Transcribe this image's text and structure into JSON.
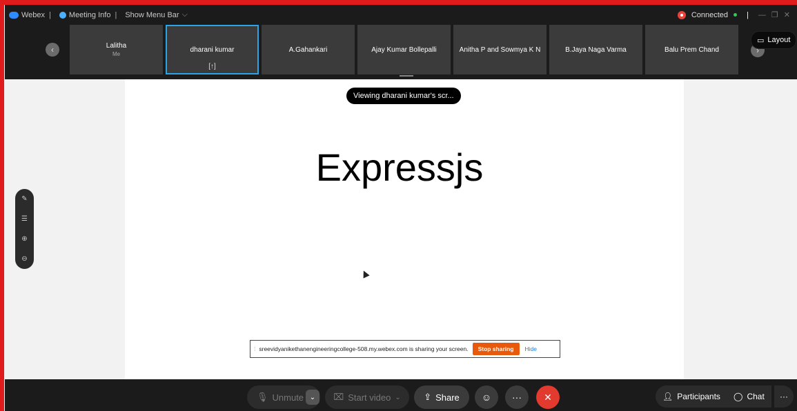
{
  "topbar": {
    "app_name": "Webex",
    "meeting_info": "Meeting Info",
    "show_menu_bar": "Show Menu Bar",
    "status": "Connected"
  },
  "participants_strip": {
    "tiles": [
      {
        "name": "Lalitha",
        "sub": "Me"
      },
      {
        "name": "dharani kumar",
        "sub": ""
      },
      {
        "name": "A.Gahankari",
        "sub": ""
      },
      {
        "name": "Ajay Kumar Bollepalli",
        "sub": ""
      },
      {
        "name": "Anitha P and Sowmya K N",
        "sub": ""
      },
      {
        "name": "B.Jaya Naga Varma",
        "sub": ""
      },
      {
        "name": "Balu Prem Chand",
        "sub": ""
      }
    ],
    "active_tile_index": 1,
    "layout_label": "Layout"
  },
  "stage": {
    "viewing_label": "Viewing dharani kumar's scr...",
    "slide_title": "Expressjs"
  },
  "share_notice": {
    "text": "sreevidyanikethanengineeringcollege-508.my.webex.com is sharing your screen.",
    "stop_label": "Stop sharing",
    "hide_label": "Hide"
  },
  "controls": {
    "unmute_label": "Unmute",
    "start_video_label": "Start video",
    "share_label": "Share",
    "participants_label": "Participants",
    "chat_label": "Chat"
  },
  "colors": {
    "frame_border": "#e01b1b",
    "active_tile_border": "#2aa6e8",
    "end_call": "#e23a2e",
    "stop_sharing": "#e8590c"
  }
}
